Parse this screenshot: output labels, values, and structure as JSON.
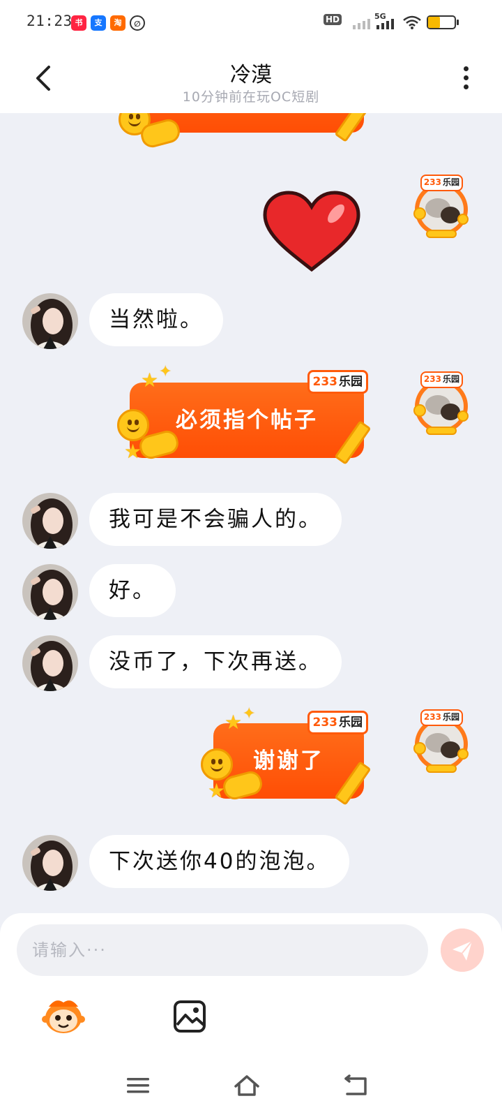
{
  "status_bar": {
    "time": "21:23",
    "apps": [
      "小红书",
      "支付宝",
      "淘宝",
      "消息"
    ],
    "hd_label": "HD",
    "network_label": "5G",
    "battery_level": 0.45,
    "battery_color": "#f8b900"
  },
  "header": {
    "title": "冷漠",
    "subtitle": "10分钟前在玩OC短剧"
  },
  "badge": {
    "num": "233",
    "text": "乐园"
  },
  "messages": [
    {
      "side": "right",
      "type": "heart-sticker"
    },
    {
      "side": "left",
      "text": "当然啦。"
    },
    {
      "side": "right",
      "type": "bubble",
      "text": "必须指个帖子"
    },
    {
      "side": "left",
      "text": "我可是不会骗人的。"
    },
    {
      "side": "left",
      "text": "好。"
    },
    {
      "side": "left",
      "text": "没币了，下次再送。"
    },
    {
      "side": "right",
      "type": "bubble",
      "text": "谢谢了"
    },
    {
      "side": "left",
      "text": "下次送你40的泡泡。"
    }
  ],
  "input": {
    "placeholder": "请输入···"
  },
  "colors": {
    "accent": "#ff5a0a",
    "bubble_yellow": "#ffc61a",
    "send_button": "#ffd3cc",
    "background": "#eef0f6"
  },
  "icons": {
    "back": "chevron-left-icon",
    "more": "more-vertical-icon",
    "send": "paper-plane-icon",
    "emoji": "monkey-face-icon",
    "image": "image-icon",
    "nav": [
      "menu-icon",
      "home-icon",
      "back-nav-icon"
    ]
  }
}
